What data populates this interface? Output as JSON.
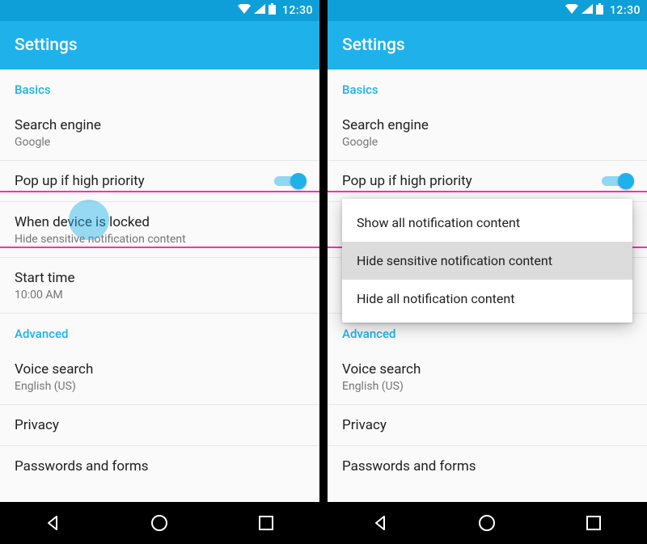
{
  "status": {
    "time": "12:30"
  },
  "appbar": {
    "title": "Settings"
  },
  "sections": {
    "basics": {
      "header": "Basics",
      "search_engine": {
        "title": "Search engine",
        "value": "Google"
      },
      "popup_priority": {
        "title": "Pop up if high priority",
        "enabled": true
      },
      "when_locked": {
        "title": "When device is locked",
        "value": "Hide sensitive notification content"
      },
      "start_time": {
        "title": "Start time",
        "value": "10:00 AM"
      }
    },
    "advanced": {
      "header": "Advanced",
      "voice_search": {
        "title": "Voice search",
        "value": "English (US)"
      },
      "privacy": {
        "title": "Privacy"
      },
      "passwords": {
        "title": "Passwords and forms"
      }
    }
  },
  "popup_menu": {
    "option_show": "Show all notification content",
    "option_hide_sensitive": "Hide sensitive notification content",
    "option_hide_all": "Hide all notification content",
    "selected_index": 1
  }
}
